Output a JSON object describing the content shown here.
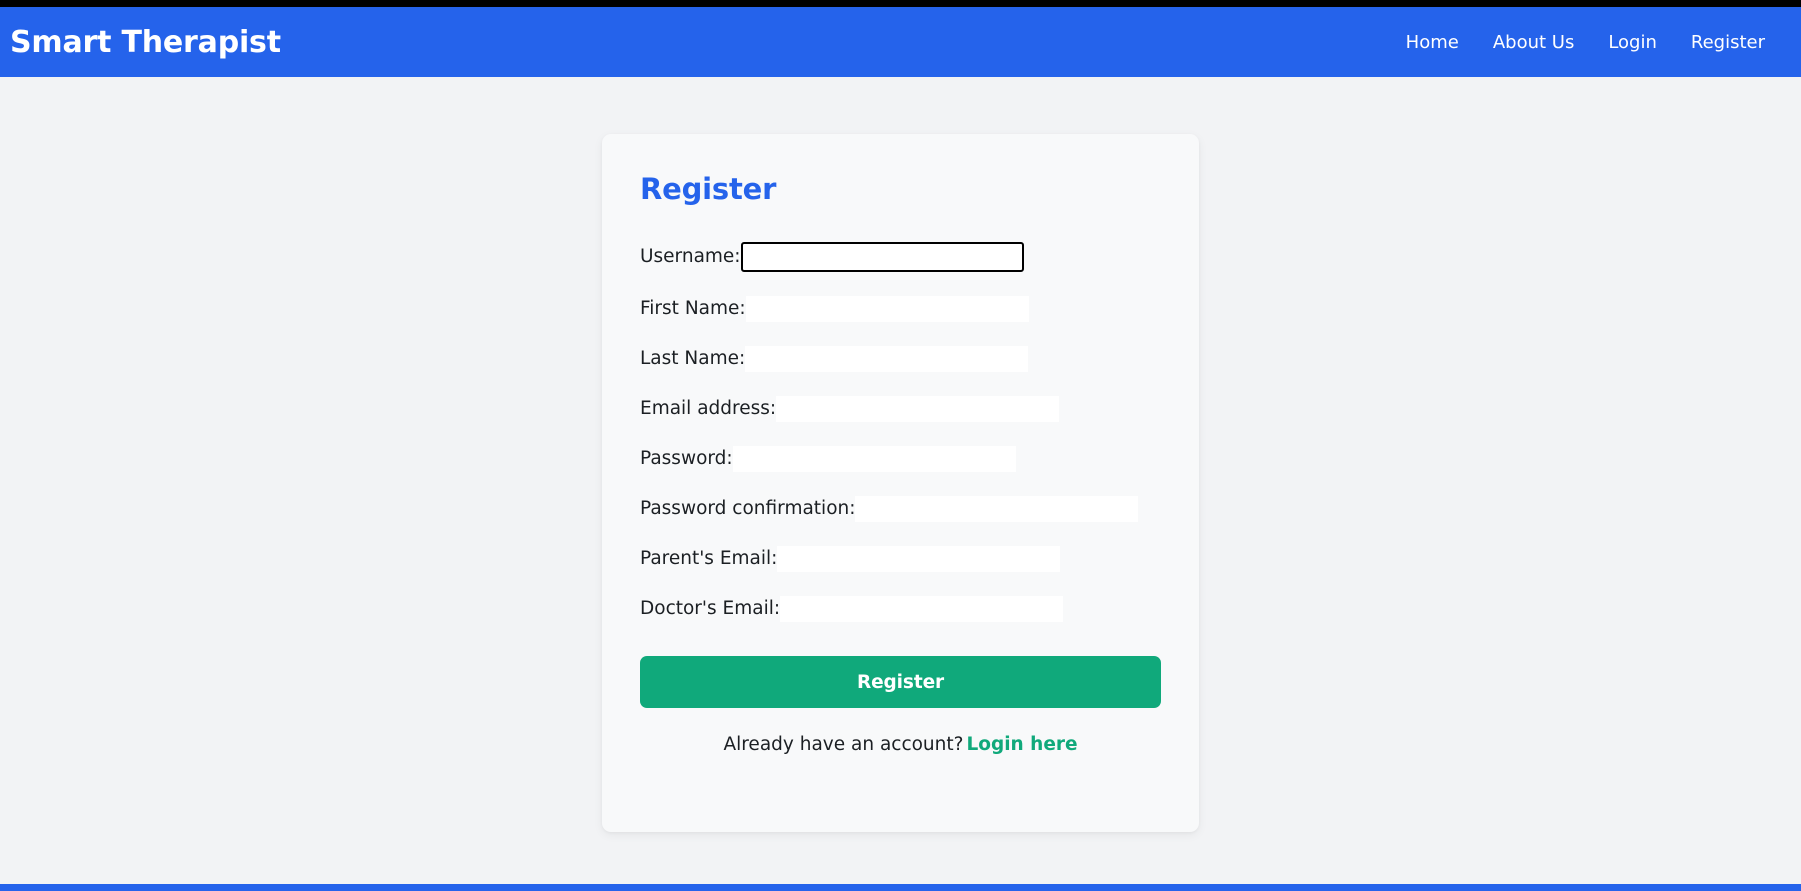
{
  "theme": {
    "brand_blue": "#2563eb",
    "accent_green": "#10a97b",
    "page_bg": "#f2f3f5",
    "card_bg": "#f8f9fa",
    "focus_outline": "#000000"
  },
  "navbar": {
    "brand": "Smart Therapist",
    "links": [
      {
        "label": "Home"
      },
      {
        "label": "About Us"
      },
      {
        "label": "Login"
      },
      {
        "label": "Register"
      }
    ]
  },
  "card": {
    "title": "Register",
    "fields": [
      {
        "label": "Username:",
        "value": "",
        "placeholder": "",
        "focused": true
      },
      {
        "label": "First Name:",
        "value": "",
        "placeholder": "",
        "focused": false
      },
      {
        "label": "Last Name:",
        "value": "",
        "placeholder": "",
        "focused": false
      },
      {
        "label": "Email address:",
        "value": "",
        "placeholder": "",
        "focused": false
      },
      {
        "label": "Password:",
        "value": "",
        "placeholder": "",
        "focused": false
      },
      {
        "label": "Password confirmation:",
        "value": "",
        "placeholder": "",
        "focused": false
      },
      {
        "label": "Parent's Email:",
        "value": "",
        "placeholder": "",
        "focused": false
      },
      {
        "label": "Doctor's Email:",
        "value": "",
        "placeholder": "",
        "focused": false
      }
    ],
    "submit_label": "Register",
    "login_hint_text": "Already have an account?",
    "login_link_label": "Login here"
  }
}
